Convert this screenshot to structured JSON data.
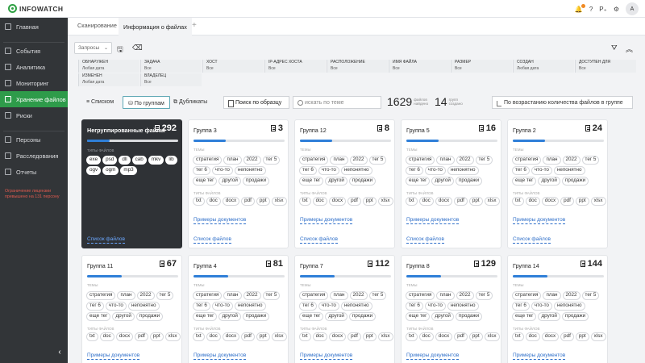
{
  "app": {
    "logo": "INFOWATCH",
    "avatar": "A"
  },
  "sidebar": {
    "items": [
      "Главная",
      "События",
      "Аналитика",
      "Мониторинг",
      "Хранение файлов",
      "Риски",
      "Персоны",
      "Расследования",
      "Отчеты"
    ],
    "license_note": "Ограничение лицензии превышено на 131 персону"
  },
  "tabs": [
    "Сканирование",
    "Информация о файлах"
  ],
  "toolbar": {
    "queries": "Запросы"
  },
  "filters": [
    {
      "label": "ОБНАРУЖЕН",
      "value": "Любая дата"
    },
    {
      "label": "ЗАДАЧА",
      "value": "Все"
    },
    {
      "label": "ХОСТ",
      "value": "Все"
    },
    {
      "label": "IP-АДРЕС ХОСТА",
      "value": "Все"
    },
    {
      "label": "РАСПОЛОЖЕНИЕ",
      "value": "Все"
    },
    {
      "label": "ИМЯ ФАЙЛА",
      "value": "Все"
    },
    {
      "label": "РАЗМЕР",
      "value": "Все"
    },
    {
      "label": "СОЗДАН",
      "value": "Любая дата"
    },
    {
      "label": "ДОСТУПЕН ДЛЯ",
      "value": "Все"
    },
    {
      "label": "ИЗМЕНЕН",
      "value": "Любая дата"
    },
    {
      "label": "ВЛАДЕЛЕЦ",
      "value": "Все"
    }
  ],
  "modes": {
    "list": "Списком",
    "groups": "По группам",
    "duplicates": "Дубликаты"
  },
  "search": {
    "sample": "Поиск по образцу",
    "placeholder": "искать по теме"
  },
  "stats": {
    "files": "1629",
    "files_label1": "файлов",
    "files_label2": "найдено",
    "groups": "14",
    "groups_label1": "групп",
    "groups_label2": "создано"
  },
  "sort": "По возрастанию количества файлов в группе",
  "ungrouped": {
    "title": "Негруппированные файлы",
    "count": "292",
    "progress": 0.25,
    "section": "ТИПЫ ФАЙЛОВ",
    "types": [
      "exe",
      "psd",
      "dll",
      "cab",
      "mkv",
      "lib",
      "ogv",
      "ogm",
      "mp3"
    ],
    "link": "Список файлов"
  },
  "section_topics": "ТЕМЫ",
  "section_types": "ТИПЫ ФАЙЛОВ",
  "topics": [
    "стратегия",
    "план",
    "2022",
    "тег 5",
    "тег 6",
    "что-то",
    "непонятно",
    "еще тег",
    "другой",
    "продажи"
  ],
  "types": [
    "txt",
    "doc",
    "docx",
    "pdf",
    "ppt",
    "xlsx"
  ],
  "link_examples": "Примеры документов",
  "link_list": "Список файлов",
  "groups": [
    {
      "title": "Группа 3",
      "count": "3",
      "progress": 0.35
    },
    {
      "title": "Группа 12",
      "count": "8",
      "progress": 0.35
    },
    {
      "title": "Группа 5",
      "count": "16",
      "progress": 0.35
    },
    {
      "title": "Группа 2",
      "count": "24",
      "progress": 0.35
    },
    {
      "title": "Группа 11",
      "count": "67",
      "progress": 0.38
    },
    {
      "title": "Группа 4",
      "count": "81",
      "progress": 0.38
    },
    {
      "title": "Группа 7",
      "count": "112",
      "progress": 0.38
    },
    {
      "title": "Группа 8",
      "count": "129",
      "progress": 0.38
    },
    {
      "title": "Группа 14",
      "count": "144",
      "progress": 0.38
    }
  ]
}
